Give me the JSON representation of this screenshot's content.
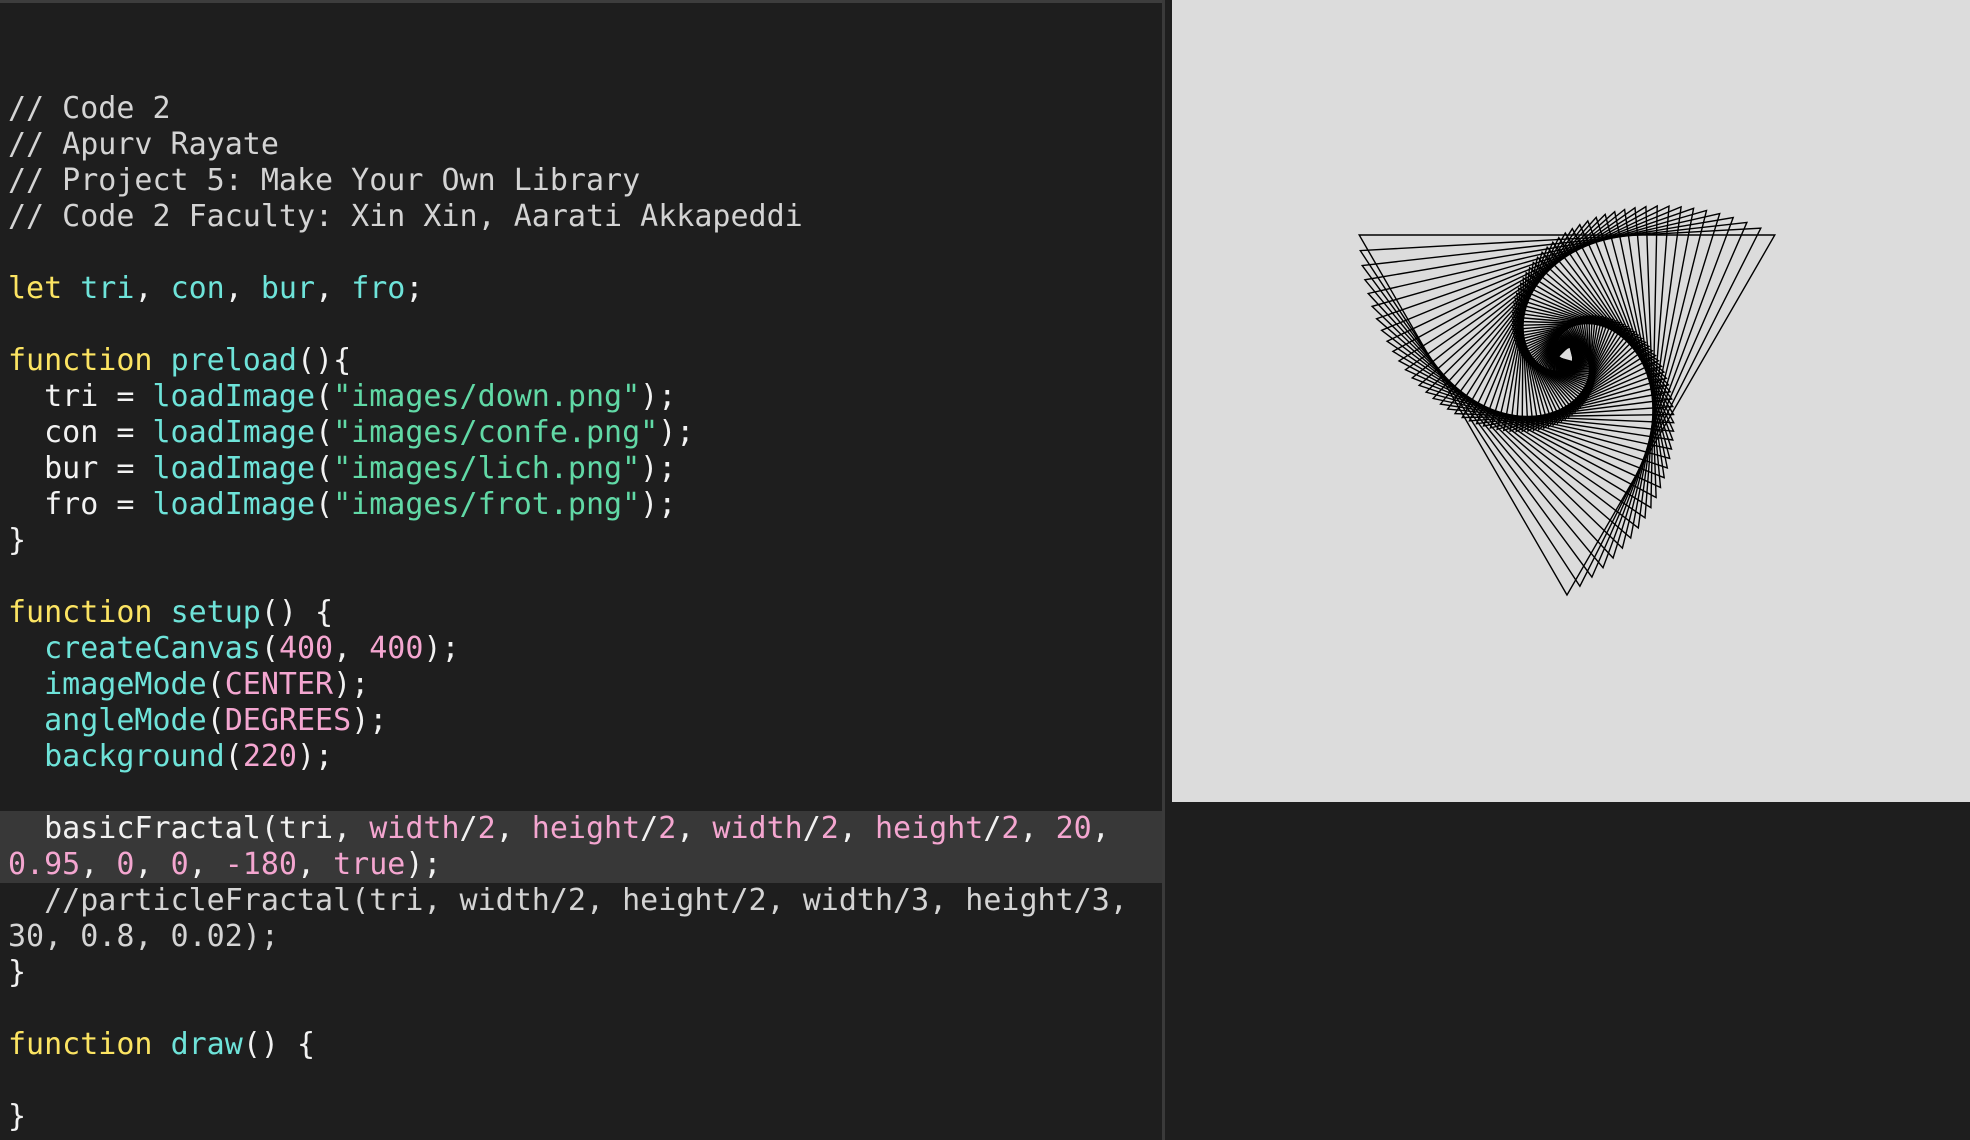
{
  "code_lines": [
    {
      "tokens": []
    },
    {
      "tokens": [
        {
          "t": "cm",
          "v": "// Code 2"
        }
      ]
    },
    {
      "tokens": [
        {
          "t": "cm",
          "v": "// Apurv Rayate"
        }
      ]
    },
    {
      "tokens": [
        {
          "t": "cm",
          "v": "// Project 5: Make Your Own Library"
        }
      ]
    },
    {
      "tokens": [
        {
          "t": "cm",
          "v": "// Code 2 Faculty: Xin Xin, Aarati Akkapeddi"
        }
      ]
    },
    {
      "tokens": []
    },
    {
      "tokens": [
        {
          "t": "kw",
          "v": "let"
        },
        {
          "t": "pl",
          "v": " "
        },
        {
          "t": "fn",
          "v": "tri"
        },
        {
          "t": "pl",
          "v": ", "
        },
        {
          "t": "fn",
          "v": "con"
        },
        {
          "t": "pl",
          "v": ", "
        },
        {
          "t": "fn",
          "v": "bur"
        },
        {
          "t": "pl",
          "v": ", "
        },
        {
          "t": "fn",
          "v": "fro"
        },
        {
          "t": "pl",
          "v": ";"
        }
      ]
    },
    {
      "tokens": []
    },
    {
      "tokens": [
        {
          "t": "kw",
          "v": "function"
        },
        {
          "t": "pl",
          "v": " "
        },
        {
          "t": "fn",
          "v": "preload"
        },
        {
          "t": "pl",
          "v": "(){"
        }
      ]
    },
    {
      "tokens": [
        {
          "t": "pl",
          "v": "  tri = "
        },
        {
          "t": "fn",
          "v": "loadImage"
        },
        {
          "t": "pl",
          "v": "("
        },
        {
          "t": "str",
          "v": "\"images/down.png\""
        },
        {
          "t": "pl",
          "v": ");"
        }
      ]
    },
    {
      "tokens": [
        {
          "t": "pl",
          "v": "  con = "
        },
        {
          "t": "fn",
          "v": "loadImage"
        },
        {
          "t": "pl",
          "v": "("
        },
        {
          "t": "str",
          "v": "\"images/confe.png\""
        },
        {
          "t": "pl",
          "v": ");"
        }
      ]
    },
    {
      "tokens": [
        {
          "t": "pl",
          "v": "  bur = "
        },
        {
          "t": "fn",
          "v": "loadImage"
        },
        {
          "t": "pl",
          "v": "("
        },
        {
          "t": "str",
          "v": "\"images/lich.png\""
        },
        {
          "t": "pl",
          "v": ");"
        }
      ]
    },
    {
      "tokens": [
        {
          "t": "pl",
          "v": "  fro = "
        },
        {
          "t": "fn",
          "v": "loadImage"
        },
        {
          "t": "pl",
          "v": "("
        },
        {
          "t": "str",
          "v": "\"images/frot.png\""
        },
        {
          "t": "pl",
          "v": ");"
        }
      ]
    },
    {
      "tokens": [
        {
          "t": "pl",
          "v": "}"
        }
      ]
    },
    {
      "tokens": []
    },
    {
      "tokens": [
        {
          "t": "kw",
          "v": "function"
        },
        {
          "t": "pl",
          "v": " "
        },
        {
          "t": "fn",
          "v": "setup"
        },
        {
          "t": "pl",
          "v": "() {"
        }
      ]
    },
    {
      "tokens": [
        {
          "t": "pl",
          "v": "  "
        },
        {
          "t": "fn",
          "v": "createCanvas"
        },
        {
          "t": "pl",
          "v": "("
        },
        {
          "t": "num",
          "v": "400"
        },
        {
          "t": "pl",
          "v": ", "
        },
        {
          "t": "num",
          "v": "400"
        },
        {
          "t": "pl",
          "v": ");"
        }
      ]
    },
    {
      "tokens": [
        {
          "t": "pl",
          "v": "  "
        },
        {
          "t": "fn",
          "v": "imageMode"
        },
        {
          "t": "pl",
          "v": "("
        },
        {
          "t": "num",
          "v": "CENTER"
        },
        {
          "t": "pl",
          "v": ");"
        }
      ]
    },
    {
      "tokens": [
        {
          "t": "pl",
          "v": "  "
        },
        {
          "t": "fn",
          "v": "angleMode"
        },
        {
          "t": "pl",
          "v": "("
        },
        {
          "t": "num",
          "v": "DEGREES"
        },
        {
          "t": "pl",
          "v": ");"
        }
      ]
    },
    {
      "tokens": [
        {
          "t": "pl",
          "v": "  "
        },
        {
          "t": "fn",
          "v": "background"
        },
        {
          "t": "pl",
          "v": "("
        },
        {
          "t": "num",
          "v": "220"
        },
        {
          "t": "pl",
          "v": ");"
        }
      ]
    },
    {
      "tokens": []
    },
    {
      "hl": true,
      "tokens": [
        {
          "t": "pl",
          "v": "  basicFractal(tri, "
        },
        {
          "t": "num",
          "v": "width"
        },
        {
          "t": "pl",
          "v": "/"
        },
        {
          "t": "num",
          "v": "2"
        },
        {
          "t": "pl",
          "v": ", "
        },
        {
          "t": "num",
          "v": "height"
        },
        {
          "t": "pl",
          "v": "/"
        },
        {
          "t": "num",
          "v": "2"
        },
        {
          "t": "pl",
          "v": ", "
        },
        {
          "t": "num",
          "v": "width"
        },
        {
          "t": "pl",
          "v": "/"
        },
        {
          "t": "num",
          "v": "2"
        },
        {
          "t": "pl",
          "v": ", "
        },
        {
          "t": "num",
          "v": "height"
        },
        {
          "t": "pl",
          "v": "/"
        },
        {
          "t": "num",
          "v": "2"
        },
        {
          "t": "pl",
          "v": ", "
        },
        {
          "t": "num",
          "v": "20"
        },
        {
          "t": "pl",
          "v": ","
        }
      ]
    },
    {
      "hl": true,
      "tokens": [
        {
          "t": "num",
          "v": "0.95"
        },
        {
          "t": "pl",
          "v": ", "
        },
        {
          "t": "num",
          "v": "0"
        },
        {
          "t": "pl",
          "v": ", "
        },
        {
          "t": "num",
          "v": "0"
        },
        {
          "t": "pl",
          "v": ", "
        },
        {
          "t": "num",
          "v": "-180"
        },
        {
          "t": "pl",
          "v": ", "
        },
        {
          "t": "num",
          "v": "true"
        },
        {
          "t": "pl",
          "v": ");"
        }
      ]
    },
    {
      "tokens": [
        {
          "t": "cm",
          "v": "  //particleFractal(tri, width/2, height/2, width/3, height/3,"
        }
      ]
    },
    {
      "tokens": [
        {
          "t": "cm",
          "v": "30, 0.8, 0.02);"
        }
      ]
    },
    {
      "tokens": [
        {
          "t": "pl",
          "v": "}"
        }
      ]
    },
    {
      "tokens": []
    },
    {
      "tokens": [
        {
          "t": "kw",
          "v": "function"
        },
        {
          "t": "pl",
          "v": " "
        },
        {
          "t": "fn",
          "v": "draw"
        },
        {
          "t": "pl",
          "v": "() {"
        }
      ]
    },
    {
      "tokens": []
    },
    {
      "tokens": [
        {
          "t": "pl",
          "v": "}"
        }
      ]
    }
  ],
  "preview": {
    "background": "#dcdcdc",
    "fractal_icon": "spiral-triangle-fractal"
  }
}
